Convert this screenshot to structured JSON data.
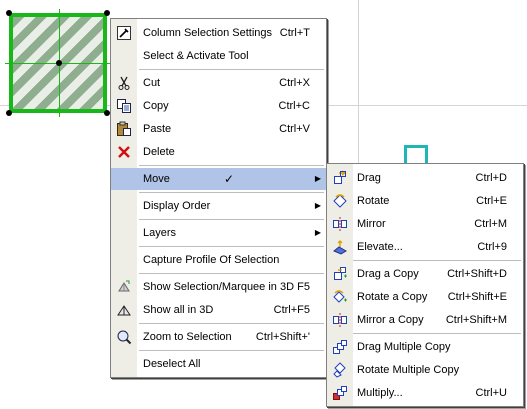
{
  "colors": {
    "selection_green": "#18b818",
    "highlight": "#b0c4e8",
    "menu_strip": "#eeede6",
    "cyan_element": "#21b6b6"
  },
  "context_menu": {
    "items": [
      {
        "label": "Column Selection Settings",
        "shortcut": "Ctrl+T",
        "icon": "settings-icon"
      },
      {
        "label": "Select & Activate Tool",
        "shortcut": "",
        "icon": ""
      },
      {
        "label": "Cut",
        "shortcut": "Ctrl+X",
        "icon": "scissors-icon"
      },
      {
        "label": "Copy",
        "shortcut": "Ctrl+C",
        "icon": "copy-icon"
      },
      {
        "label": "Paste",
        "shortcut": "Ctrl+V",
        "icon": "paste-icon"
      },
      {
        "label": "Delete",
        "shortcut": "",
        "icon": "delete-icon"
      },
      {
        "label": "Move",
        "shortcut": "",
        "icon": "",
        "checkmark": "✓",
        "submenu": true
      },
      {
        "label": "Display Order",
        "shortcut": "",
        "icon": "",
        "submenu": true
      },
      {
        "label": "Layers",
        "shortcut": "",
        "icon": "",
        "submenu": true
      },
      {
        "label": "Capture Profile Of Selection",
        "shortcut": "",
        "icon": ""
      },
      {
        "label": "Show Selection/Marquee in 3D",
        "shortcut": "F5",
        "icon": "show-3d-icon"
      },
      {
        "label": "Show all in 3D",
        "shortcut": "Ctrl+F5",
        "icon": "show-all-3d-icon"
      },
      {
        "label": "Zoom to Selection",
        "shortcut": "Ctrl+Shift+'",
        "icon": "zoom-icon"
      },
      {
        "label": "Deselect All",
        "shortcut": "",
        "icon": ""
      }
    ]
  },
  "move_submenu": {
    "items": [
      {
        "label": "Drag",
        "shortcut": "Ctrl+D",
        "icon": "drag-icon"
      },
      {
        "label": "Rotate",
        "shortcut": "Ctrl+E",
        "icon": "rotate-icon"
      },
      {
        "label": "Mirror",
        "shortcut": "Ctrl+M",
        "icon": "mirror-icon"
      },
      {
        "label": "Elevate...",
        "shortcut": "Ctrl+9",
        "icon": "elevate-icon"
      },
      {
        "label": "Drag a Copy",
        "shortcut": "Ctrl+Shift+D",
        "icon": "drag-copy-icon"
      },
      {
        "label": "Rotate a Copy",
        "shortcut": "Ctrl+Shift+E",
        "icon": "rotate-copy-icon"
      },
      {
        "label": "Mirror a Copy",
        "shortcut": "Ctrl+Shift+M",
        "icon": "mirror-copy-icon"
      },
      {
        "label": "Drag Multiple Copy",
        "shortcut": "",
        "icon": "drag-multiple-icon"
      },
      {
        "label": "Rotate Multiple Copy",
        "shortcut": "",
        "icon": "rotate-multiple-icon"
      },
      {
        "label": "Multiply...",
        "shortcut": "Ctrl+U",
        "icon": "multiply-icon"
      }
    ]
  }
}
